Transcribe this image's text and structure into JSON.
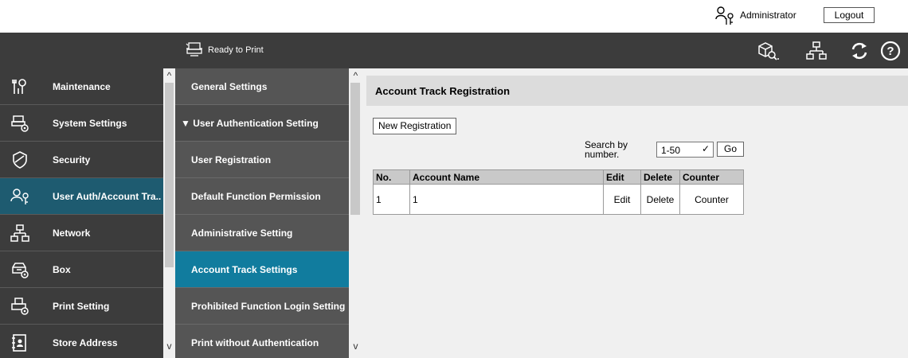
{
  "header": {
    "user_name": "Administrator",
    "logout_label": "Logout",
    "status_text": "Ready to Print"
  },
  "left_menu": {
    "items": [
      {
        "label": "Maintenance",
        "icon": "maintenance-icon"
      },
      {
        "label": "System Settings",
        "icon": "system-settings-icon"
      },
      {
        "label": "Security",
        "icon": "shield-icon"
      },
      {
        "label": "User Auth/Account Tra..",
        "icon": "user-auth-icon",
        "active": true
      },
      {
        "label": "Network",
        "icon": "network-icon"
      },
      {
        "label": "Box",
        "icon": "box-icon"
      },
      {
        "label": "Print Setting",
        "icon": "print-setting-icon"
      },
      {
        "label": "Store Address",
        "icon": "address-book-icon"
      }
    ]
  },
  "sub_menu": {
    "items": [
      {
        "label": "General Settings"
      },
      {
        "label": "▼ User Authentication Setting",
        "parent": true
      },
      {
        "label": "User Registration"
      },
      {
        "label": "Default Function Permission"
      },
      {
        "label": "Administrative Setting"
      },
      {
        "label": "Account Track Settings",
        "active": true
      },
      {
        "label": "Prohibited Function Login Setting"
      },
      {
        "label": "Print without Authentication"
      }
    ]
  },
  "main": {
    "title": "Account Track Registration",
    "new_registration_label": "New Registration",
    "search_label": "Search by number.",
    "search_range": "1-50",
    "go_label": "Go",
    "table": {
      "headers": [
        "No.",
        "Account Name",
        "Edit",
        "Delete",
        "Counter"
      ],
      "rows": [
        {
          "no": "1",
          "name": "1",
          "edit": "Edit",
          "delete": "Delete",
          "counter": "Counter"
        }
      ]
    }
  },
  "colors": {
    "dark_bar": "#3c3c3c",
    "submenu_bg": "#555555",
    "active_left": "#1e5b70",
    "active_sub": "#117c9e",
    "content_bg": "#f0f0f0"
  }
}
